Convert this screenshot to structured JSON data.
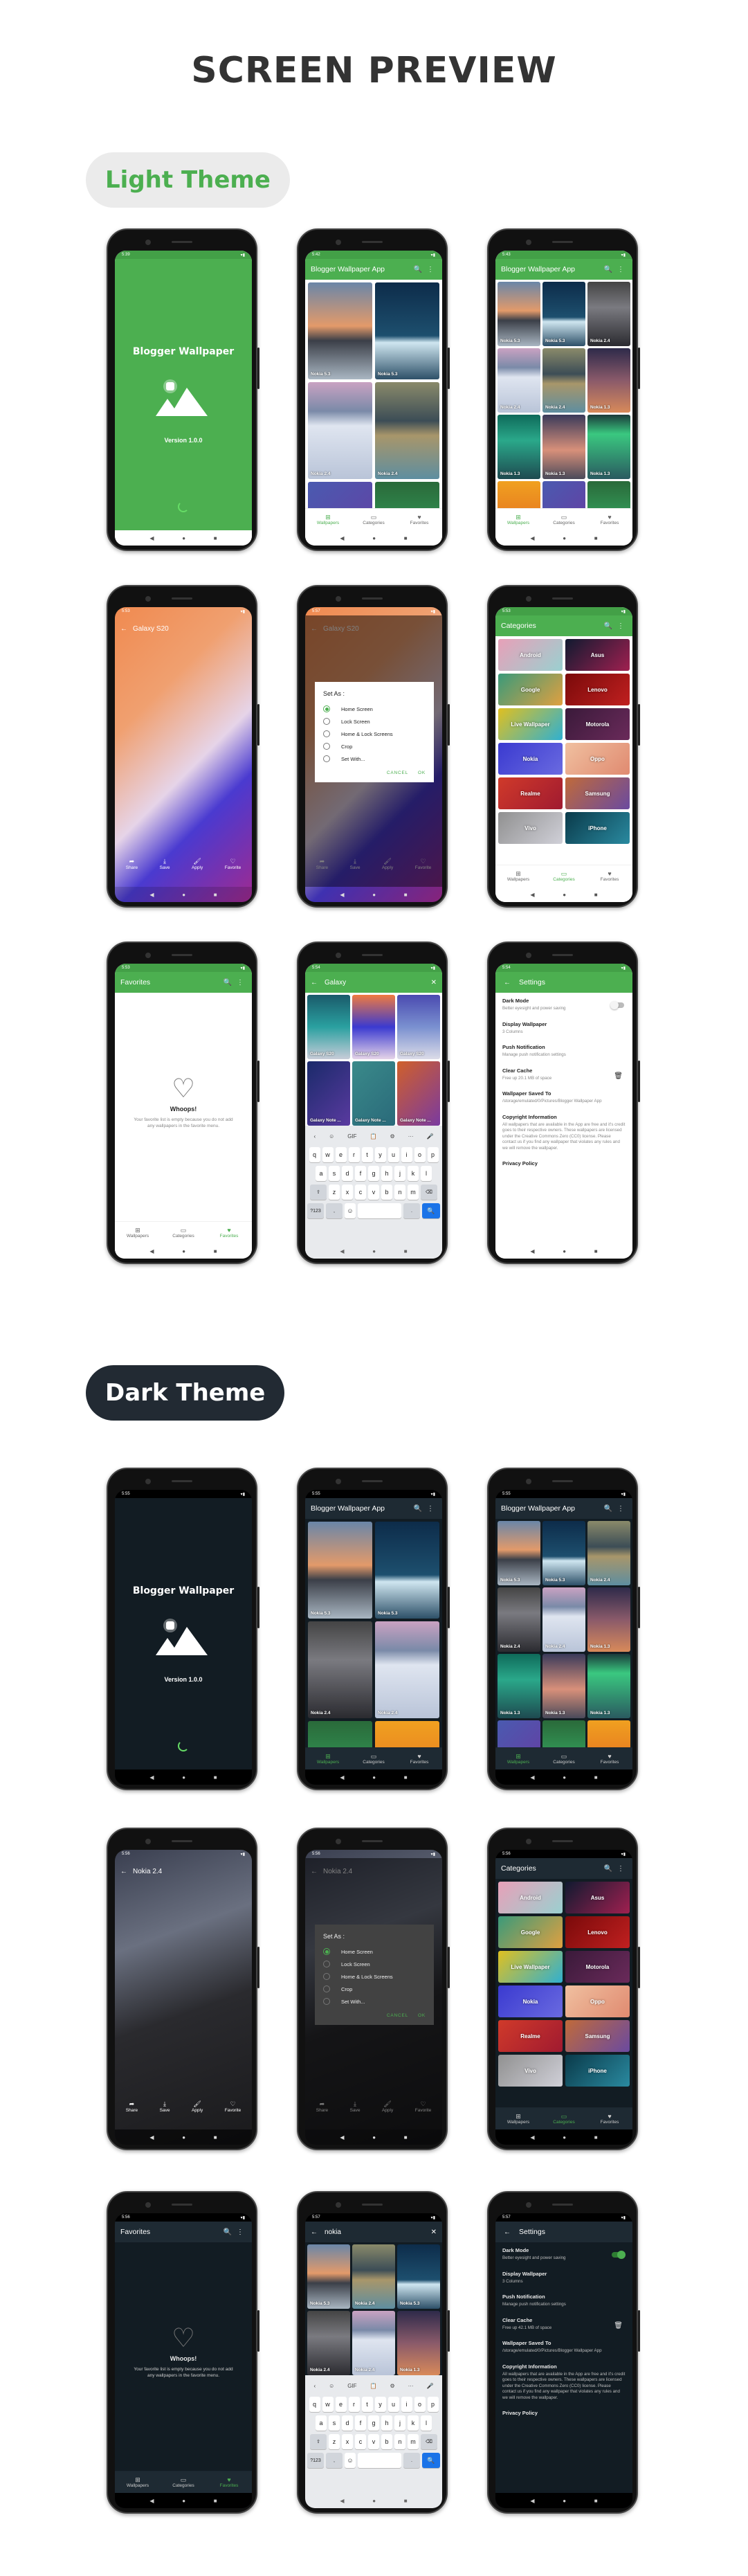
{
  "page_title": "SCREEN PREVIEW",
  "sections": {
    "light_label": "Light Theme",
    "dark_label": "Dark Theme"
  },
  "colors": {
    "accent": "#4caf50",
    "light_bg": "#ffffff",
    "dark_bg": "#121c23",
    "dark_bar": "#1e2a33",
    "pill_dark": "#222a33"
  },
  "icons": {
    "wifi": "▾",
    "battery": "▮",
    "search": "🔍",
    "more": "⋮",
    "back": "←",
    "close": "✕",
    "nav_back": "◀",
    "nav_home": "●",
    "nav_recent": "■",
    "grid": "⊞",
    "categories": "▭",
    "heart": "♥",
    "heart_outline": "♡",
    "share": "➦",
    "save": "⤓",
    "apply": "🖌",
    "trash": "🗑"
  },
  "app": {
    "name": "Blogger Wallpaper",
    "version": "Version 1.0.0",
    "appbar_title": "Blogger Wallpaper App",
    "bottom_nav": [
      "Wallpapers",
      "Categories",
      "Favorites"
    ]
  },
  "light": {
    "splash": {
      "time": "5:39"
    },
    "grid2": {
      "time": "5:42",
      "tiles": [
        "Nokia 5.3",
        "Nokia 5.3",
        "Nokia 2.4",
        "Nokia 2.4",
        "",
        ""
      ]
    },
    "grid3": {
      "time": "5:43",
      "tiles": [
        "Nokia 5.3",
        "Nokia 5.3",
        "Nokia 2.4",
        "Nokia 2.4",
        "Nokia 2.4",
        "Nokia 1.3",
        "Nokia 1.3",
        "Nokia 1.3",
        "Nokia 1.3",
        "",
        "",
        ""
      ]
    },
    "viewer": {
      "time": "5:53",
      "title": "Galaxy S20",
      "actions": [
        "Share",
        "Save",
        "Apply",
        "Favorite"
      ]
    },
    "dialog": {
      "time": "5:57",
      "title": "Set As :",
      "options": [
        "Home Screen",
        "Lock Screen",
        "Home & Lock Screens",
        "Crop",
        "Set With..."
      ],
      "selected": 0,
      "cancel": "CANCEL",
      "ok": "OK"
    },
    "categories": {
      "time": "5:53",
      "title": "Categories",
      "items": [
        "Android",
        "Asus",
        "Google",
        "Lenovo",
        "Live Wallpaper",
        "Motorola",
        "Nokia",
        "Oppo",
        "Realme",
        "Samsung",
        "Vivo",
        "iPhone"
      ]
    },
    "favorites": {
      "time": "5:53",
      "title": "Favorites",
      "empty_title": "Whoops!",
      "empty_text": "Your favorite list is empty because you do not add any wallpapers in the favorite menu."
    },
    "search": {
      "time": "5:54",
      "query": "Galaxy",
      "tiles": [
        "Galaxy S20",
        "Galaxy S20",
        "Galaxy S20",
        "Galaxy Note ...",
        "Galaxy Note ...",
        "Galaxy Note ...",
        "",
        ""
      ]
    },
    "settings": {
      "time": "5:54",
      "title": "Settings",
      "dark_mode_on": false,
      "cache": "Free up 20.1 MB of space"
    }
  },
  "dark": {
    "splash": {
      "time": "5:55"
    },
    "grid2": {
      "time": "5:55",
      "tiles": [
        "Nokia 5.3",
        "Nokia 5.3",
        "Nokia 2.4",
        "Nokia 2.4",
        "",
        ""
      ]
    },
    "grid3": {
      "time": "5:55",
      "tiles": [
        "Nokia 5.3",
        "Nokia 5.3",
        "Nokia 2.4",
        "Nokia 2.4",
        "Nokia 2.4",
        "Nokia 1.3",
        "Nokia 1.3",
        "Nokia 1.3",
        "Nokia 1.3",
        "",
        "",
        ""
      ]
    },
    "viewer": {
      "time": "5:56",
      "title": "Nokia 2.4",
      "actions": [
        "Share",
        "Save",
        "Apply",
        "Favorite"
      ]
    },
    "dialog": {
      "time": "5:56",
      "title": "Set As :",
      "options": [
        "Home Screen",
        "Lock Screen",
        "Home & Lock Screens",
        "Crop",
        "Set With..."
      ],
      "selected": 0,
      "cancel": "CANCEL",
      "ok": "OK"
    },
    "categories": {
      "time": "5:56",
      "title": "Categories",
      "items": [
        "Android",
        "Asus",
        "Google",
        "Lenovo",
        "Live Wallpaper",
        "Motorola",
        "Nokia",
        "Oppo",
        "Realme",
        "Samsung",
        "Vivo",
        "iPhone"
      ]
    },
    "favorites": {
      "time": "5:56",
      "title": "Favorites",
      "empty_title": "Whoops!",
      "empty_text": "Your favorite list is empty because you do not add any wallpapers in the favorite menu."
    },
    "search": {
      "time": "5:57",
      "query": "nokia",
      "tiles": [
        "Nokia 5.3",
        "Nokia 2.4",
        "Nokia 5.3",
        "Nokia 2.4",
        "Nokia 2.4",
        "Nokia 1.3",
        "",
        "",
        ""
      ]
    },
    "settings": {
      "time": "5:57",
      "title": "Settings",
      "dark_mode_on": true,
      "cache": "Free up 42.1 MB of space"
    }
  },
  "settings_items": [
    {
      "title": "Dark Mode",
      "sub": "Better eyesight and power saving"
    },
    {
      "title": "Display Wallpaper",
      "sub": "3 Columns"
    },
    {
      "title": "Push Notification",
      "sub": "Manage push notification settings"
    },
    {
      "title": "Clear Cache",
      "sub": ""
    },
    {
      "title": "Wallpaper Saved To",
      "sub": "/storage/emulated/0/Pictures/Blogger Wallpaper App"
    },
    {
      "title": "Copyright Information",
      "sub": "All wallpapers that are available in the App are free and it's credit goes to their respective owners. These wallpapers are licensed under the Creative Commons Zero (CC0) license. Please contact us if you find any wallpaper that violates any rules and we will remove the wallpaper."
    },
    {
      "title": "Privacy Policy",
      "sub": ""
    }
  ],
  "keyboard": {
    "toolbar": [
      "‹",
      "☺",
      "GIF",
      "📋",
      "⚙",
      "···",
      "🎤"
    ],
    "row1": [
      "q",
      "w",
      "e",
      "r",
      "t",
      "y",
      "u",
      "i",
      "o",
      "p"
    ],
    "row2": [
      "a",
      "s",
      "d",
      "f",
      "g",
      "h",
      "j",
      "k",
      "l"
    ],
    "row3": [
      "⇧",
      "z",
      "x",
      "c",
      "v",
      "b",
      "n",
      "m",
      "⌫"
    ],
    "row4": [
      "?123",
      ",",
      "☺",
      "",
      ".",
      "🔍"
    ]
  }
}
